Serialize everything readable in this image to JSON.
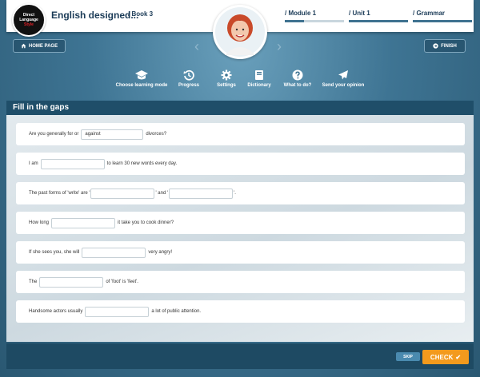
{
  "header": {
    "logo_lines": [
      "Direct",
      "Language",
      "Style"
    ],
    "course_title": "English designed...",
    "book": "/ Book 3",
    "breadcrumbs": [
      {
        "label": "/ Module 1",
        "progress": 0.33
      },
      {
        "label": "/ Unit 1",
        "progress": 1.0
      },
      {
        "label": "/ Grammar",
        "progress": 1.0
      }
    ]
  },
  "nav": {
    "home_label": "HOME PAGE",
    "finish_label": "FINISH",
    "prev_arrow": "‹",
    "next_arrow": "›"
  },
  "tools": [
    {
      "label": "Choose learning mode",
      "icon": "graduation-cap-icon"
    },
    {
      "label": "Progress",
      "icon": "history-icon"
    },
    {
      "label": "Settings",
      "icon": "gear-icon"
    },
    {
      "label": "Dictionary",
      "icon": "book-icon"
    },
    {
      "label": "What to do?",
      "icon": "question-icon"
    },
    {
      "label": "Send your opinion",
      "icon": "paper-plane-icon"
    }
  ],
  "exercise": {
    "title": "Fill in the gaps",
    "rows": [
      {
        "before": "Are you generally for or",
        "gap1": "against",
        "after": "divorces?"
      },
      {
        "before": "I am",
        "gap1": "",
        "after": "to learn 30 new words every day."
      },
      {
        "before": "The past forms of 'write' are '",
        "gap1": "",
        "middle": "' and '",
        "gap2": "",
        "after": "'."
      },
      {
        "before": "How long",
        "gap1": "",
        "after": "it take you to cook dinner?"
      },
      {
        "before": "If she sees you, she will",
        "gap1": "",
        "after": "very angry!"
      },
      {
        "before": "The",
        "gap1": "",
        "after": "of 'foot' is 'feet'."
      },
      {
        "before": "Handsome actors usually",
        "gap1": "",
        "after": "a lot of public attention."
      }
    ]
  },
  "footer": {
    "skip_label": "SKIP",
    "check_label": "CHECK",
    "check_mark": "✔"
  },
  "colors": {
    "accent_orange": "#f39a1d",
    "header_dark": "#1f4e69",
    "page_blue": "#3f7290"
  }
}
